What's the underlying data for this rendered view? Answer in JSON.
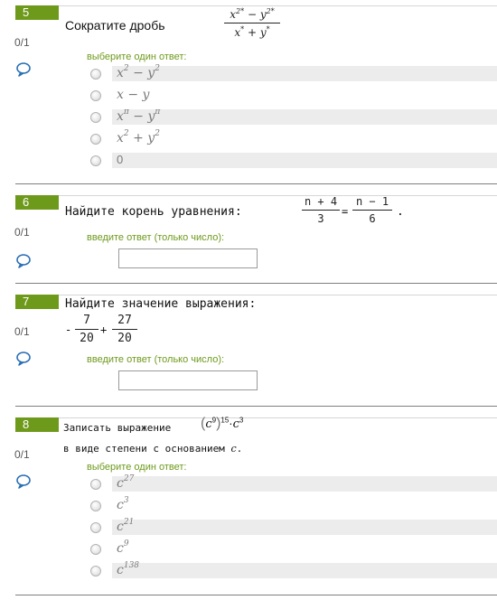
{
  "questions": [
    {
      "number": "5",
      "grade": "0/1",
      "text": "Сократите дробь",
      "formula": {
        "num_base1": "x",
        "num_exp1": "2*",
        "num_op": "−",
        "num_base2": "y",
        "num_exp2": "2*",
        "den_base1": "x",
        "den_exp1": "*",
        "den_op": "+",
        "den_base2": "y",
        "den_exp2": "*"
      },
      "prompt": "выберите один ответ:",
      "options": [
        {
          "base": "x",
          "sup": "2",
          "op": " − ",
          "base2": "y",
          "sup2": "2"
        },
        {
          "base": "x",
          "sup": "",
          "op": " − ",
          "base2": "y",
          "sup2": ""
        },
        {
          "base": "x",
          "sup": "π",
          "op": " − ",
          "base2": "y",
          "sup2": "π"
        },
        {
          "base": "x",
          "sup": "2",
          "op": " + ",
          "base2": "y",
          "sup2": "2"
        },
        {
          "base": "0",
          "sup": "",
          "op": "",
          "base2": "",
          "sup2": ""
        }
      ]
    },
    {
      "number": "6",
      "grade": "0/1",
      "text": "Найдите корень уравнения:",
      "formula": {
        "left_num": "n + 4",
        "left_den": "3",
        "eq": "=",
        "right_num": "n − 1",
        "right_den": "6",
        "end": "."
      },
      "prompt": "введите ответ (только число):",
      "input_value": ""
    },
    {
      "number": "7",
      "grade": "0/1",
      "text": "Найдите значение выражения:",
      "formula": {
        "sign": "-",
        "num1": "7",
        "den1": "20",
        "op": "+",
        "num2": "27",
        "den2": "20"
      },
      "prompt": "введите ответ (только число):",
      "input_value": ""
    },
    {
      "number": "8",
      "grade": "0/1",
      "text": "Записать выражение",
      "formula": {
        "base_inner": "c",
        "exp_inner": "9",
        "exp_outer": "15",
        "dot": "·",
        "base2": "c",
        "exp2": "3"
      },
      "text2": "в виде степени с основанием",
      "text2_var": "c",
      "text2_end": ".",
      "prompt": "выберите один ответ:",
      "options": [
        {
          "base": "c",
          "sup": "27"
        },
        {
          "base": "c",
          "sup": "3"
        },
        {
          "base": "c",
          "sup": "21"
        },
        {
          "base": "c",
          "sup": "9"
        },
        {
          "base": "c",
          "sup": "138"
        }
      ]
    }
  ],
  "colors": {
    "accent": "#6e9a1c",
    "option_bg": "#ececec",
    "separator": "#7f7f7f"
  },
  "icons": {
    "comment": "comment-bubble-icon"
  }
}
